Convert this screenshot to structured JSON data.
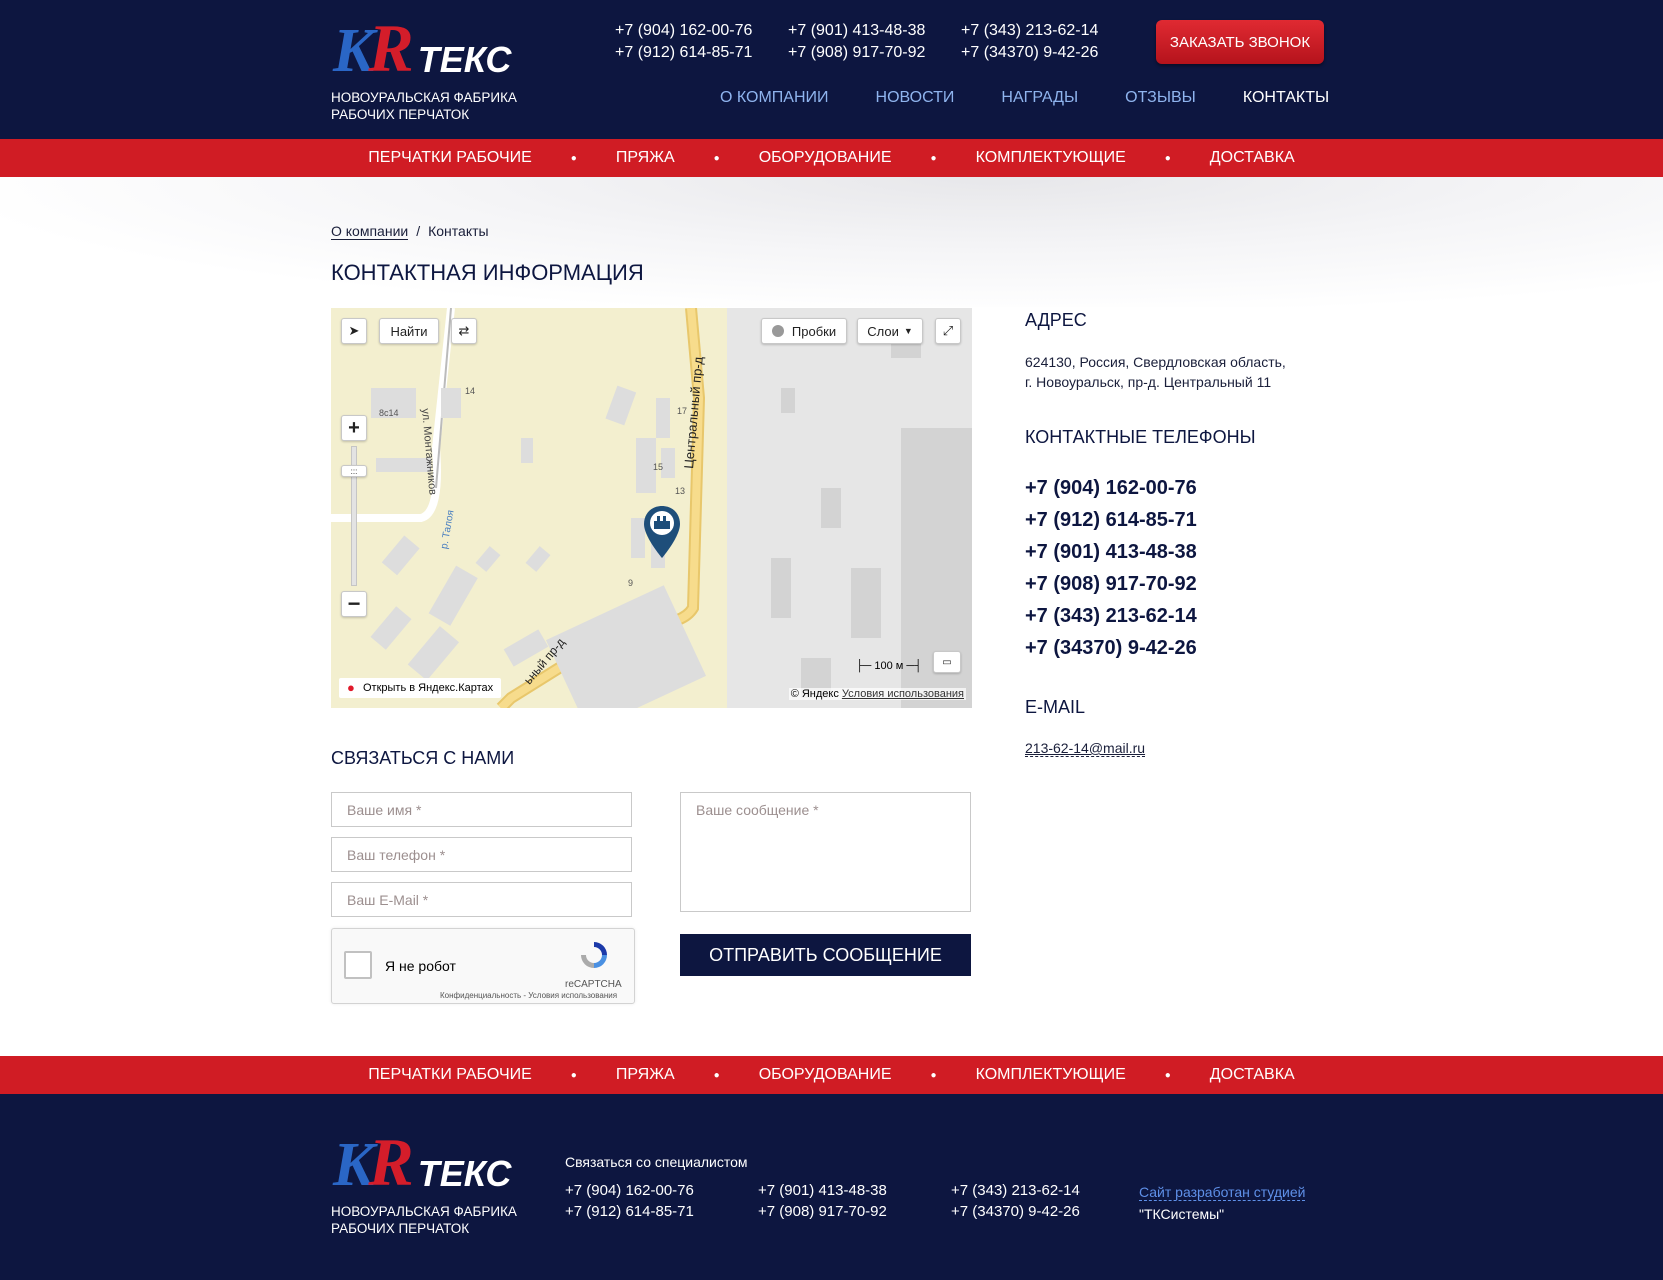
{
  "brand": {
    "k": "K",
    "r": "R",
    "text": "ТЕКС",
    "tagline_line1": "НОВОУРАЛЬСКАЯ ФАБРИКА",
    "tagline_line2": "РАБОЧИХ ПЕРЧАТОК"
  },
  "header": {
    "phones": [
      "+7 (904) 162-00-76",
      "+7 (901) 413-48-38",
      "+7 (343) 213-62-14",
      "+7 (912) 614-85-71",
      "+7 (908) 917-70-92",
      "+7 (34370) 9-42-26"
    ],
    "callback_label": "ЗАКАЗАТЬ ЗВОНОК",
    "nav": [
      "О КОМПАНИИ",
      "НОВОСТИ",
      "НАГРАДЫ",
      "ОТЗЫВЫ",
      "КОНТАКТЫ"
    ]
  },
  "catnav": [
    "ПЕРЧАТКИ РАБОЧИЕ",
    "ПРЯЖА",
    "ОБОРУДОВАНИЕ",
    "КОМПЛЕКТУЮЩИЕ",
    "ДОСТАВКА"
  ],
  "breadcrumb": {
    "parent": "О компании",
    "sep": "/",
    "current": "Контакты"
  },
  "page_title": "КОНТАКТНАЯ ИНФОРМАЦИЯ",
  "map": {
    "find_label": "Найти",
    "traffic_label": "Пробки",
    "layers_label": "Слои",
    "open_label": "Открыть в Яндекс.Картах",
    "copyright": "© Яндекс",
    "terms": "Условия использования",
    "scale": "100 м",
    "streets": [
      "ул. Монтажников",
      "Центральный пр-д",
      "р. Талоя",
      "ьный пр-д"
    ],
    "house_numbers": [
      "8с14",
      "14",
      "17",
      "15",
      "13",
      "9"
    ]
  },
  "contacts": {
    "address_title": "АДРЕС",
    "address_line1": "624130, Россия, Свердловская область,",
    "address_line2": "г. Новоуральск, пр-д. Центральный 11",
    "phones_title": "КОНТАКТНЫЕ ТЕЛЕФОНЫ",
    "phones": [
      "+7 (904) 162-00-76",
      "+7 (912) 614-85-71",
      "+7 (901) 413-48-38",
      "+7 (908) 917-70-92",
      "+7 (343) 213-62-14",
      "+7 (34370) 9-42-26"
    ],
    "email_title": "E-MAIL",
    "email": "213-62-14@mail.ru"
  },
  "form": {
    "title": "СВЯЗАТЬСЯ С НАМИ",
    "name_placeholder": "Ваше имя *",
    "phone_placeholder": "Ваш телефон *",
    "email_placeholder": "Ваш E-Mail *",
    "message_placeholder": "Ваше сообщение *",
    "captcha_label": "Я не робот",
    "captcha_brand": "reCAPTCHA",
    "captcha_terms": "Конфиденциальность - Условия использования",
    "submit_label": "ОТПРАВИТЬ СООБЩЕНИЕ"
  },
  "footer": {
    "contact_title": "Связаться со специалистом",
    "phones": [
      "+7 (904) 162-00-76",
      "+7 (901) 413-48-38",
      "+7 (343) 213-62-14",
      "+7 (912) 614-85-71",
      "+7 (908) 917-70-92",
      "+7 (34370) 9-42-26"
    ],
    "dev_link": "Сайт разработан студией",
    "dev_studio": "\"ТКСистемы\""
  },
  "colors": {
    "navy": "#0d1640",
    "red": "#d01c24",
    "link_blue": "#8fb4ee"
  }
}
